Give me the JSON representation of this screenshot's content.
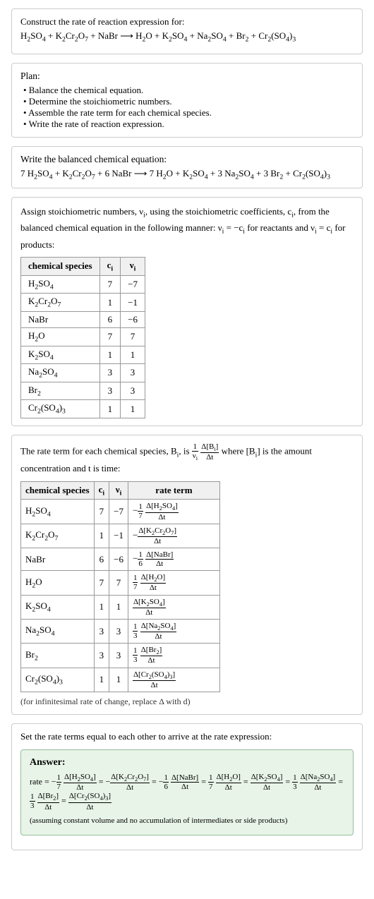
{
  "header": {
    "construct_label": "Construct the rate of reaction expression for:",
    "initial_equation": "H₂SO₄ + K₂Cr₂O₇ + NaBr ⟶ H₂O + K₂SO₄ + Na₂SO₄ + Br₂ + Cr₂(SO₄)₃"
  },
  "plan": {
    "title": "Plan:",
    "items": [
      "• Balance the chemical equation.",
      "• Determine the stoichiometric numbers.",
      "• Assemble the rate term for each chemical species.",
      "• Write the rate of reaction expression."
    ]
  },
  "balanced": {
    "title": "Write the balanced chemical equation:",
    "equation": "7 H₂SO₄ + K₂Cr₂O₇ + 6 NaBr ⟶ 7 H₂O + K₂SO₄ + 3 Na₂SO₄ + 3 Br₂ + Cr₂(SO₄)₃"
  },
  "assign": {
    "intro": "Assign stoichiometric numbers, νᵢ, using the stoichiometric coefficients, cᵢ, from the balanced chemical equation in the following manner: νᵢ = −cᵢ for reactants and νᵢ = cᵢ for products:",
    "table_headers": [
      "chemical species",
      "cᵢ",
      "νᵢ"
    ],
    "rows": [
      {
        "species": "H₂SO₄",
        "c": "7",
        "v": "−7"
      },
      {
        "species": "K₂Cr₂O₇",
        "c": "1",
        "v": "−1"
      },
      {
        "species": "NaBr",
        "c": "6",
        "v": "−6"
      },
      {
        "species": "H₂O",
        "c": "7",
        "v": "7"
      },
      {
        "species": "K₂SO₄",
        "c": "1",
        "v": "1"
      },
      {
        "species": "Na₂SO₄",
        "c": "3",
        "v": "3"
      },
      {
        "species": "Br₂",
        "c": "3",
        "v": "3"
      },
      {
        "species": "Cr₂(SO₄)₃",
        "c": "1",
        "v": "1"
      }
    ]
  },
  "rate_term": {
    "intro": "The rate term for each chemical species, Bᵢ, is",
    "formula_desc": "1/νᵢ · Δ[Bᵢ]/Δt",
    "middle": "where [Bᵢ] is the amount concentration and t is time:",
    "table_headers": [
      "chemical species",
      "cᵢ",
      "νᵢ",
      "rate term"
    ],
    "rows": [
      {
        "species": "H₂SO₄",
        "c": "7",
        "v": "−7",
        "rate": "−(1/7) Δ[H₂SO₄]/Δt"
      },
      {
        "species": "K₂Cr₂O₇",
        "c": "1",
        "v": "−1",
        "rate": "−Δ[K₂Cr₂O₇]/Δt"
      },
      {
        "species": "NaBr",
        "c": "6",
        "v": "−6",
        "rate": "−(1/6) Δ[NaBr]/Δt"
      },
      {
        "species": "H₂O",
        "c": "7",
        "v": "7",
        "rate": "(1/7) Δ[H₂O]/Δt"
      },
      {
        "species": "K₂SO₄",
        "c": "1",
        "v": "1",
        "rate": "Δ[K₂SO₄]/Δt"
      },
      {
        "species": "Na₂SO₄",
        "c": "3",
        "v": "3",
        "rate": "(1/3) Δ[Na₂SO₄]/Δt"
      },
      {
        "species": "Br₂",
        "c": "3",
        "v": "3",
        "rate": "(1/3) Δ[Br₂]/Δt"
      },
      {
        "species": "Cr₂(SO₄)₃",
        "c": "1",
        "v": "1",
        "rate": "Δ[Cr₂(SO₄)₃]/Δt"
      }
    ],
    "note": "(for infinitesimal rate of change, replace Δ with d)"
  },
  "set_rate": {
    "title": "Set the rate terms equal to each other to arrive at the rate expression:",
    "answer_label": "Answer:",
    "rate_expression": "rate = −(1/7) Δ[H₂SO₄]/Δt = −Δ[K₂Cr₂O₇]/Δt = −(1/6) Δ[NaBr]/Δt = (1/7) Δ[H₂O]/Δt = Δ[K₂SO₄]/Δt = (1/3) Δ[Na₂SO₄]/Δt = (1/3) Δ[Br₂]/Δt = Δ[Cr₂(SO₄)₃]/Δt",
    "note": "(assuming constant volume and no accumulation of intermediates or side products)"
  }
}
